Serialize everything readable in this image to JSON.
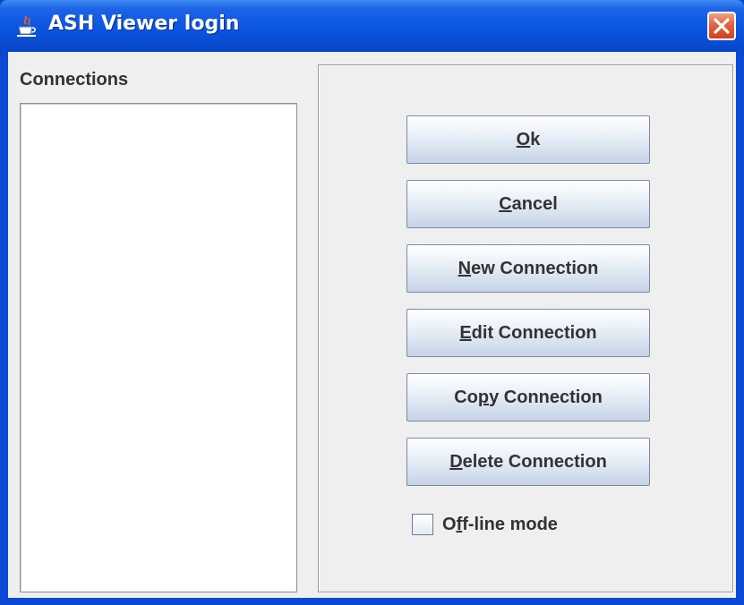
{
  "window": {
    "title": "ASH Viewer login",
    "app_icon": "java-cup-icon",
    "close_icon": "close-icon",
    "titlebar_color": "#0a55e1",
    "close_button_color": "#e16340"
  },
  "connections": {
    "label": "Connections",
    "items": []
  },
  "buttons": {
    "ok": {
      "mnemonic": "O",
      "rest": "k"
    },
    "cancel": {
      "mnemonic": "C",
      "rest": "ancel"
    },
    "new_connection": {
      "mnemonic": "N",
      "rest": "ew Connection"
    },
    "edit_connection": {
      "mnemonic": "E",
      "rest": "dit Connection"
    },
    "copy_connection": {
      "pre": "Co",
      "mnemonic": "p",
      "rest": "y Connection"
    },
    "delete_connection": {
      "mnemonic": "D",
      "rest": "elete Connection"
    }
  },
  "offline_mode": {
    "checked": false,
    "pre": "O",
    "mnemonic": "f",
    "rest": "f-line mode"
  }
}
